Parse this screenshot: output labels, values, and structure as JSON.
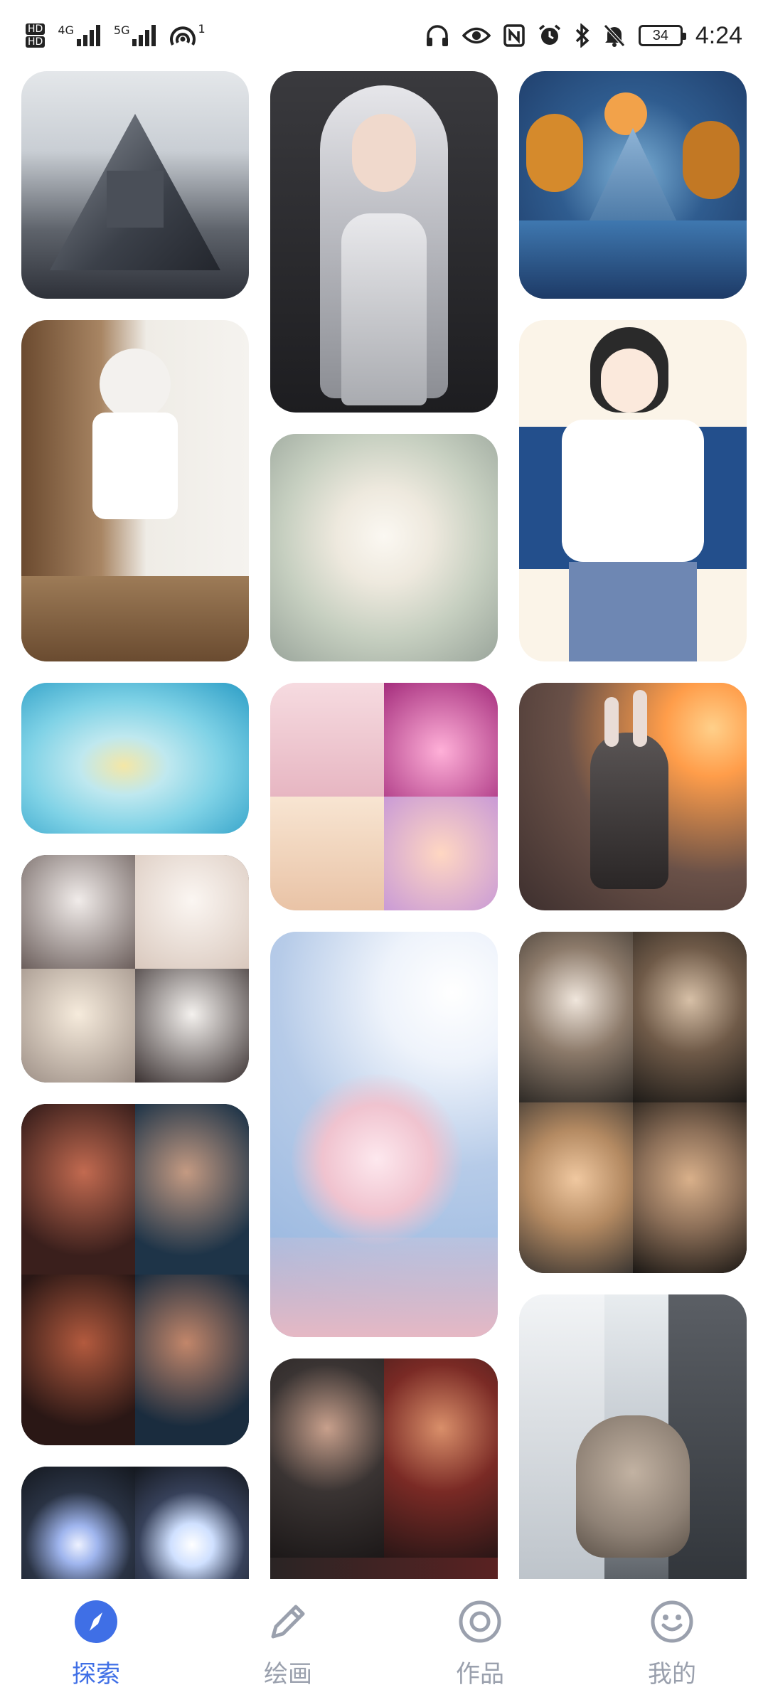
{
  "status_bar": {
    "left_hd_top": "HD",
    "left_hd_bottom": "HD",
    "signal1_label": "4G",
    "signal2_label": "5G",
    "hotspot_count": "1",
    "battery_level": "34",
    "time": "4:24",
    "icons": [
      "headphones-icon",
      "eye-icon",
      "nfc-icon",
      "alarm-icon",
      "bluetooth-icon",
      "mute-icon"
    ]
  },
  "nav": {
    "active_color": "#3f6fe6",
    "inactive_color": "#9aa0ad",
    "items": [
      {
        "label": "探索",
        "icon": "compass-icon",
        "active": true
      },
      {
        "label": "绘画",
        "icon": "pencil-icon",
        "active": false
      },
      {
        "label": "作品",
        "icon": "target-icon",
        "active": false
      },
      {
        "label": "我的",
        "icon": "smiley-icon",
        "active": false
      }
    ]
  },
  "gallery": [
    {
      "subject": "mountain-house",
      "colors": [
        "#d9dde3",
        "#5b616b",
        "#2a2f38"
      ]
    },
    {
      "subject": "silver-hair-woman",
      "colors": [
        "#2b2b2e",
        "#c8c8cc",
        "#1a1a1d"
      ]
    },
    {
      "subject": "paper-art-landscape",
      "colors": [
        "#1d3a66",
        "#d58a2c",
        "#7cb0d6"
      ]
    },
    {
      "subject": "anime-girl-window",
      "colors": [
        "#f2efe9",
        "#6b4a2f",
        "#c9b59a"
      ]
    },
    {
      "subject": "fluffy-puppy",
      "colors": [
        "#bfc8b8",
        "#f4efe6",
        "#9aa59b"
      ]
    },
    {
      "subject": "manga-girl-tshirt",
      "colors": [
        "#fbf4e8",
        "#234f8c",
        "#6e87b3"
      ]
    },
    {
      "subject": "girl-in-water",
      "colors": [
        "#7fd2e6",
        "#2a9cc5",
        "#f4e7a6"
      ]
    },
    {
      "subject": "pink-drinks",
      "colors": [
        "#f1c9cf",
        "#c23a8a",
        "#f7d9b0",
        "#e2a4d6"
      ]
    },
    {
      "subject": "rabbit-knight",
      "colors": [
        "#ff9d4a",
        "#3d2f2e",
        "#6a5148"
      ]
    },
    {
      "subject": "girls-with-sheep",
      "colors": [
        "#5a4f4d",
        "#f0e7e2",
        "#efe0d5",
        "#3b3232"
      ]
    },
    {
      "subject": "cherry-blossom",
      "colors": [
        "#8fb0dc",
        "#f4f7fb",
        "#f0c3cf"
      ]
    },
    {
      "subject": "kittens",
      "colors": [
        "#3b3632",
        "#c8a68a",
        "#2a2623",
        "#8c6f58"
      ]
    },
    {
      "subject": "warrior-faces",
      "colors": [
        "#7a2b25",
        "#1e3448",
        "#a6432d",
        "#1a2c3e"
      ]
    },
    {
      "subject": "warrior-women",
      "colors": [
        "#3a3433",
        "#7a2a25",
        "#2a2424",
        "#5a2222"
      ]
    },
    {
      "subject": "snow-cat",
      "colors": [
        "#d8dde2",
        "#8e8175",
        "#454a50"
      ]
    },
    {
      "subject": "glowing-creature",
      "colors": [
        "#14181f",
        "#cfe0ff",
        "#2a3344"
      ]
    }
  ]
}
